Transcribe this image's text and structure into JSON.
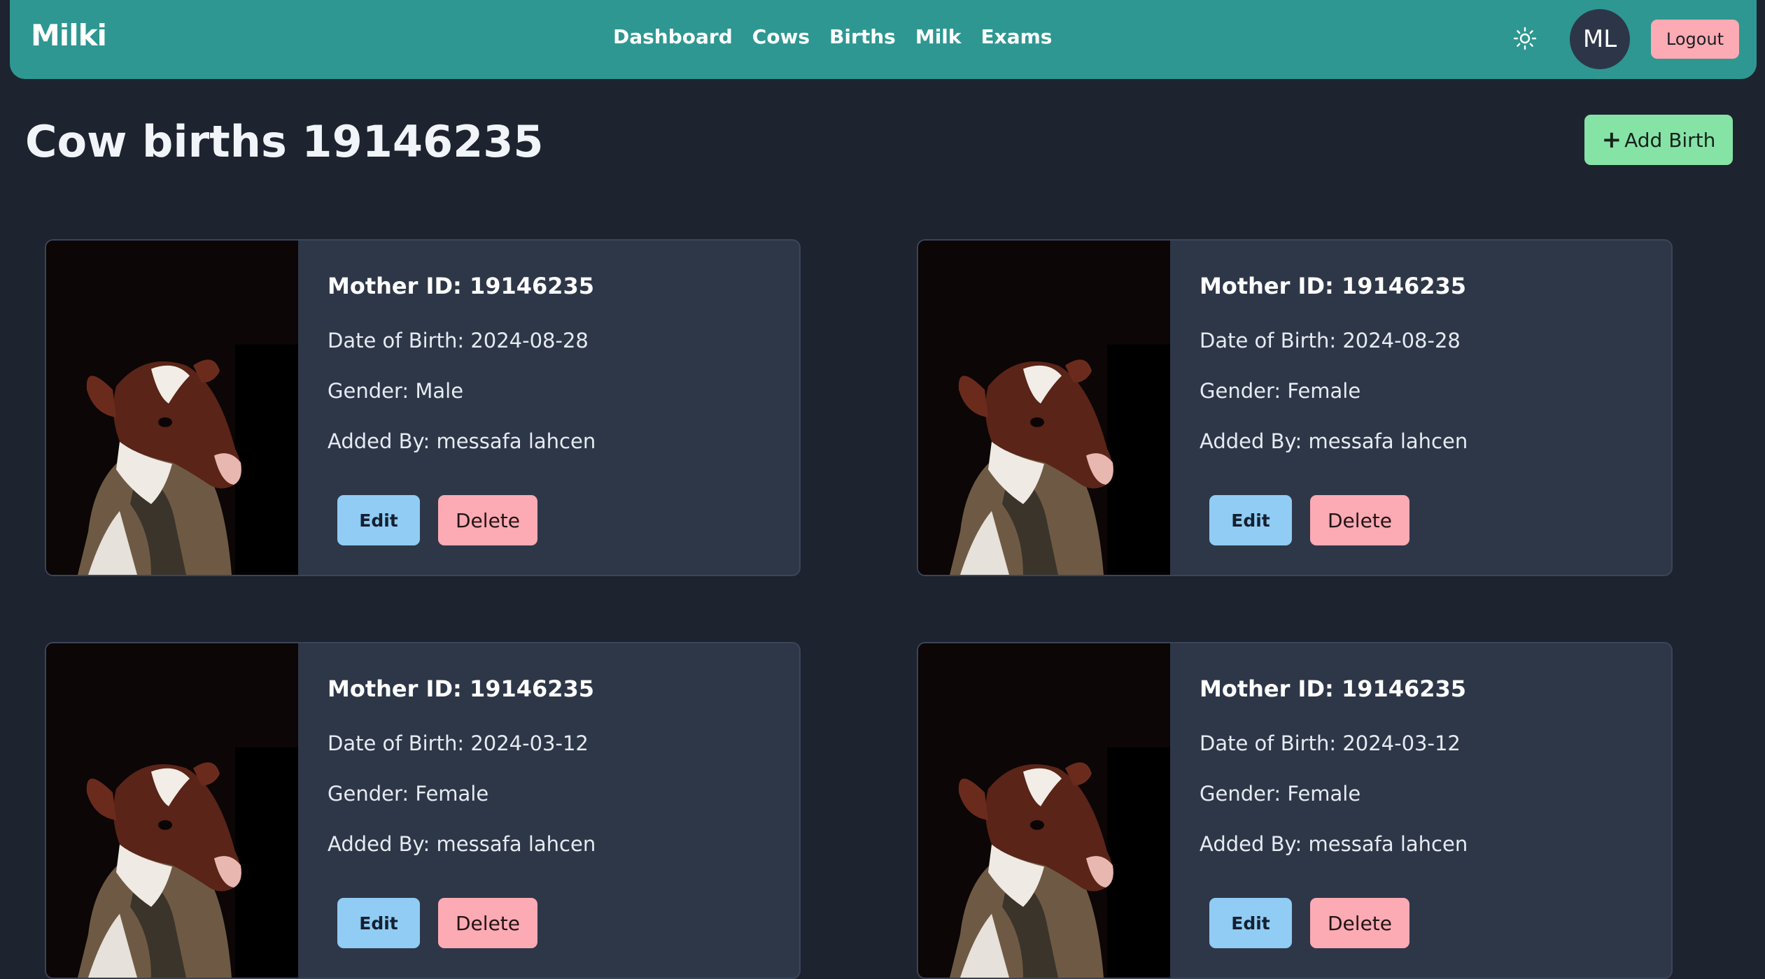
{
  "navbar": {
    "brand": "Milki",
    "links": [
      "Dashboard",
      "Cows",
      "Births",
      "Milk",
      "Exams"
    ],
    "avatar_initials": "ML",
    "logout_label": "Logout",
    "theme_icon": "sun-icon"
  },
  "page": {
    "title": "Cow births 19146235",
    "add_birth_label": "Add Birth",
    "add_birth_icon": "plus-icon"
  },
  "births": [
    {
      "mother_id": "Mother ID: 19146235",
      "date_of_birth": "Date of Birth: 2024-08-28",
      "gender": "Gender: Male",
      "added_by": "Added By: messafa lahcen",
      "edit_label": "Edit",
      "delete_label": "Delete"
    },
    {
      "mother_id": "Mother ID: 19146235",
      "date_of_birth": "Date of Birth: 2024-08-28",
      "gender": "Gender: Female",
      "added_by": "Added By: messafa lahcen",
      "edit_label": "Edit",
      "delete_label": "Delete"
    },
    {
      "mother_id": "Mother ID: 19146235",
      "date_of_birth": "Date of Birth: 2024-03-12",
      "gender": "Gender: Female",
      "added_by": "Added By: messafa lahcen",
      "edit_label": "Edit",
      "delete_label": "Delete"
    },
    {
      "mother_id": "Mother ID: 19146235",
      "date_of_birth": "Date of Birth: 2024-03-12",
      "gender": "Gender: Female",
      "added_by": "Added By: messafa lahcen",
      "edit_label": "Edit",
      "delete_label": "Delete"
    }
  ],
  "colors": {
    "navbar": "#2e9791",
    "background": "#1d232f",
    "card": "#2e3748",
    "edit_button": "#90ccf4",
    "delete_button": "#fcaab3",
    "add_button": "#86e3a6"
  }
}
